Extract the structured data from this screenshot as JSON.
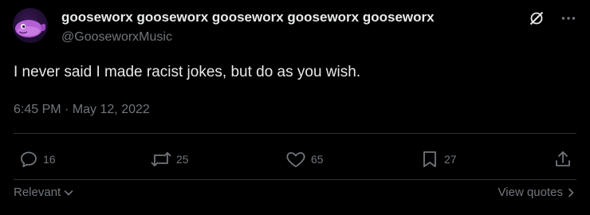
{
  "tweet": {
    "author": {
      "display_name": "gooseworx gooseworx gooseworx gooseworx gooseworx",
      "handle": "@GooseworxMusic",
      "avatar_icon": "purple-whale-avatar"
    },
    "text": "I never said I made racist jokes, but do as you wish.",
    "time": "6:45 PM",
    "separator": "·",
    "date": "May 12, 2022"
  },
  "header_icons": [
    "grok-icon",
    "more-icon"
  ],
  "actions": {
    "replies": {
      "icon": "reply-icon",
      "count": "16"
    },
    "reposts": {
      "icon": "repost-icon",
      "count": "25"
    },
    "likes": {
      "icon": "like-icon",
      "count": "65"
    },
    "bookmarks": {
      "icon": "bookmark-icon",
      "count": "27"
    },
    "share": {
      "icon": "share-icon"
    }
  },
  "footer": {
    "sort_label": "Relevant",
    "view_quotes_label": "View quotes"
  },
  "colors": {
    "background": "#000000",
    "primary_text": "#e7e9ea",
    "secondary_text": "#71767b",
    "divider": "#2f3336",
    "avatar_accent": "#b55fd6"
  }
}
